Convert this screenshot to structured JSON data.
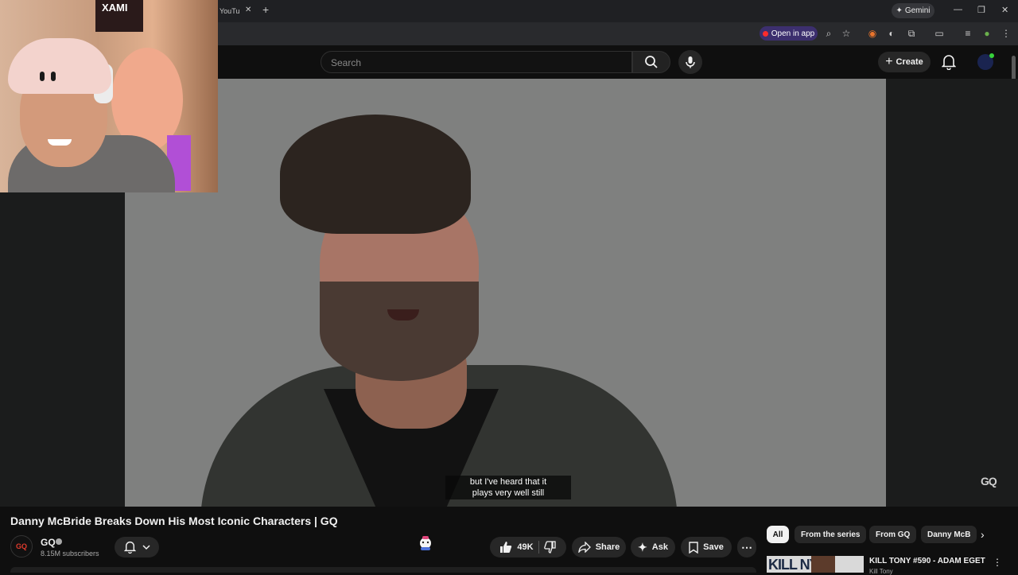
{
  "browser": {
    "tab_title": "YouTu",
    "tab_close": "✕",
    "new_tab": "+",
    "gemini_label": "Gemini",
    "open_in_app": "Open in app",
    "window_controls": {
      "minimize": "—",
      "restore": "❐",
      "close": "✕"
    }
  },
  "header": {
    "search_placeholder": "Search",
    "create_label": "Create"
  },
  "webcam": {
    "poster_text": "XAMI"
  },
  "video": {
    "caption_line1": "but I've heard that it",
    "caption_line2": "plays very well still",
    "watermark": "GQ"
  },
  "info": {
    "title": "Danny McBride Breaks Down His Most Iconic Characters | GQ",
    "channel": {
      "name": "GQ",
      "avatar_text": "GQ",
      "subscribers": "8.15M subscribers"
    },
    "actions": {
      "likes": "49K",
      "share": "Share",
      "ask": "Ask",
      "save": "Save"
    }
  },
  "sidebar": {
    "chips": [
      "All",
      "From the series",
      "From GQ",
      "Danny McB"
    ],
    "related": [
      {
        "thumb_text": "KILL  NY",
        "title": "KILL TONY #590 - ADAM EGET",
        "channel": "Kill Tony"
      }
    ]
  },
  "colors": {
    "background": "#0f0f0f",
    "chip_active": "#f1f1f1",
    "open_in_app_bg": "#3c2f6e",
    "gq_red": "#e03b2d"
  }
}
